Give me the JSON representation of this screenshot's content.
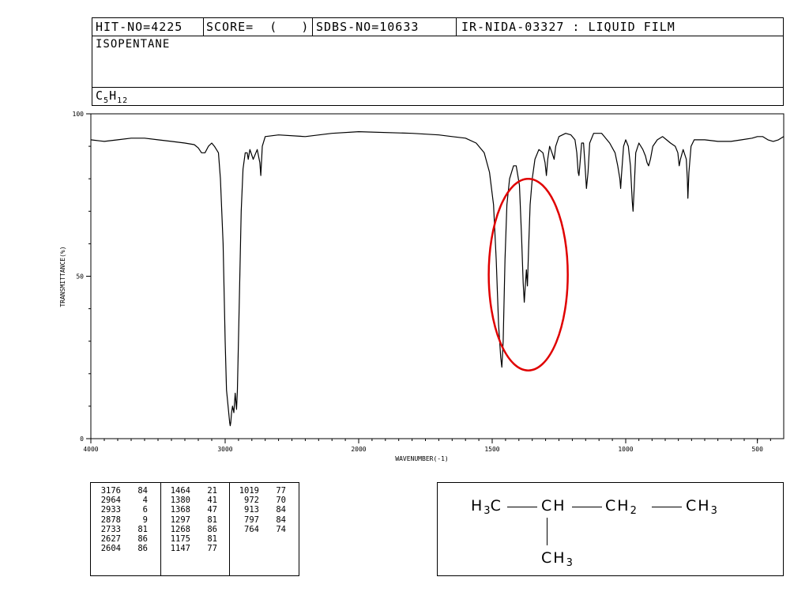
{
  "header": {
    "hit_no": "HIT-NO=4225",
    "score": "SCORE=  (   )",
    "sdbs_no": "SDBS-NO=10633",
    "ir_info": "IR-NIDA-03327 : LIQUID FILM",
    "compound_name": "ISOPENTANE",
    "formula": {
      "c": "C",
      "c_count": "5",
      "h": "H",
      "h_count": "12"
    }
  },
  "chart_data": {
    "type": "line",
    "xlabel": "WAVENUMBER(-1)",
    "ylabel": "TRANSMITTANCE(%)",
    "xlim": [
      4000,
      400
    ],
    "ylim": [
      0,
      100
    ],
    "x_ticks": [
      4000,
      3000,
      2000,
      1500,
      1000,
      500
    ],
    "x_tick_labels": [
      "4000",
      "3000",
      "2000",
      "1500",
      "1000",
      "500"
    ],
    "y_ticks": [
      0,
      50,
      100
    ],
    "y_tick_labels": [
      "0",
      "50",
      "100"
    ],
    "grid": false,
    "series": [
      {
        "color": "#000000",
        "points": [
          [
            4000,
            92
          ],
          [
            3900,
            91.5
          ],
          [
            3800,
            92
          ],
          [
            3700,
            92.5
          ],
          [
            3600,
            92.5
          ],
          [
            3500,
            92
          ],
          [
            3400,
            91.5
          ],
          [
            3300,
            91
          ],
          [
            3230,
            90.5
          ],
          [
            3200,
            89.5
          ],
          [
            3176,
            88
          ],
          [
            3150,
            88
          ],
          [
            3125,
            90
          ],
          [
            3100,
            91
          ],
          [
            3080,
            90
          ],
          [
            3050,
            88
          ],
          [
            3035,
            80
          ],
          [
            3015,
            60
          ],
          [
            3000,
            30
          ],
          [
            2990,
            15
          ],
          [
            2978,
            10
          ],
          [
            2966,
            5
          ],
          [
            2962,
            4
          ],
          [
            2958,
            5
          ],
          [
            2952,
            8
          ],
          [
            2945,
            10
          ],
          [
            2935,
            8
          ],
          [
            2925,
            14
          ],
          [
            2915,
            9
          ],
          [
            2908,
            15
          ],
          [
            2895,
            40
          ],
          [
            2880,
            70
          ],
          [
            2866,
            83
          ],
          [
            2850,
            88
          ],
          [
            2835,
            88
          ],
          [
            2827,
            86
          ],
          [
            2815,
            89
          ],
          [
            2790,
            86
          ],
          [
            2760,
            89
          ],
          [
            2740,
            85
          ],
          [
            2733,
            81
          ],
          [
            2722,
            90
          ],
          [
            2700,
            93
          ],
          [
            2600,
            93.5
          ],
          [
            2400,
            93
          ],
          [
            2200,
            94
          ],
          [
            2000,
            94.5
          ],
          [
            1800,
            94
          ],
          [
            1700,
            93.5
          ],
          [
            1650,
            93
          ],
          [
            1600,
            92.5
          ],
          [
            1560,
            91
          ],
          [
            1530,
            88
          ],
          [
            1510,
            82
          ],
          [
            1495,
            72
          ],
          [
            1485,
            55
          ],
          [
            1476,
            35
          ],
          [
            1468,
            25
          ],
          [
            1464,
            22
          ],
          [
            1459,
            30
          ],
          [
            1452,
            55
          ],
          [
            1445,
            72
          ],
          [
            1435,
            80
          ],
          [
            1420,
            84
          ],
          [
            1410,
            84
          ],
          [
            1398,
            78
          ],
          [
            1390,
            62
          ],
          [
            1384,
            48
          ],
          [
            1380,
            42
          ],
          [
            1376,
            47
          ],
          [
            1372,
            52
          ],
          [
            1368,
            47
          ],
          [
            1364,
            58
          ],
          [
            1358,
            72
          ],
          [
            1350,
            80
          ],
          [
            1340,
            86
          ],
          [
            1325,
            89
          ],
          [
            1310,
            88
          ],
          [
            1302,
            85
          ],
          [
            1297,
            81
          ],
          [
            1292,
            86
          ],
          [
            1285,
            90
          ],
          [
            1276,
            88
          ],
          [
            1268,
            86
          ],
          [
            1262,
            90
          ],
          [
            1250,
            93
          ],
          [
            1225,
            94
          ],
          [
            1205,
            93.5
          ],
          [
            1190,
            92
          ],
          [
            1183,
            88
          ],
          [
            1178,
            82
          ],
          [
            1175,
            81
          ],
          [
            1172,
            84
          ],
          [
            1165,
            91
          ],
          [
            1158,
            91
          ],
          [
            1153,
            85
          ],
          [
            1147,
            77
          ],
          [
            1141,
            82
          ],
          [
            1135,
            91
          ],
          [
            1120,
            94
          ],
          [
            1090,
            94
          ],
          [
            1060,
            91
          ],
          [
            1040,
            88
          ],
          [
            1030,
            84
          ],
          [
            1022,
            80
          ],
          [
            1019,
            77
          ],
          [
            1016,
            81
          ],
          [
            1008,
            90
          ],
          [
            1000,
            92
          ],
          [
            990,
            90
          ],
          [
            982,
            84
          ],
          [
            975,
            73
          ],
          [
            972,
            70
          ],
          [
            968,
            77
          ],
          [
            962,
            88
          ],
          [
            950,
            91
          ],
          [
            935,
            89
          ],
          [
            925,
            87
          ],
          [
            919,
            85
          ],
          [
            913,
            84
          ],
          [
            906,
            86
          ],
          [
            897,
            90
          ],
          [
            880,
            92
          ],
          [
            860,
            93
          ],
          [
            845,
            92
          ],
          [
            830,
            91
          ],
          [
            812,
            90
          ],
          [
            802,
            88
          ],
          [
            797,
            84
          ],
          [
            792,
            86
          ],
          [
            782,
            89
          ],
          [
            770,
            86
          ],
          [
            766,
            80
          ],
          [
            764,
            74
          ],
          [
            760,
            82
          ],
          [
            752,
            90
          ],
          [
            740,
            92
          ],
          [
            700,
            92
          ],
          [
            650,
            91.5
          ],
          [
            600,
            91.5
          ],
          [
            560,
            92
          ],
          [
            520,
            92.5
          ],
          [
            500,
            93
          ],
          [
            480,
            93
          ],
          [
            460,
            92
          ],
          [
            440,
            91.5
          ],
          [
            420,
            92
          ],
          [
            400,
            93
          ]
        ]
      }
    ],
    "annotations": [
      {
        "shape": "ellipse",
        "color": "#e00000",
        "cx": 1365,
        "cy": 50.5,
        "rx": 148,
        "ry": 29.5
      }
    ]
  },
  "peak_table": [
    [
      {
        "wn": "3176",
        "t": "84"
      },
      {
        "wn": "2964",
        "t": "4"
      },
      {
        "wn": "2933",
        "t": "6"
      },
      {
        "wn": "2878",
        "t": "9"
      },
      {
        "wn": "2733",
        "t": "81"
      },
      {
        "wn": "2627",
        "t": "86"
      },
      {
        "wn": "2604",
        "t": "86"
      }
    ],
    [
      {
        "wn": "1464",
        "t": "21"
      },
      {
        "wn": "1380",
        "t": "41"
      },
      {
        "wn": "1368",
        "t": "47"
      },
      {
        "wn": "1297",
        "t": "81"
      },
      {
        "wn": "1268",
        "t": "86"
      },
      {
        "wn": "1175",
        "t": "81"
      },
      {
        "wn": "1147",
        "t": "77"
      }
    ],
    [
      {
        "wn": "1019",
        "t": "77"
      },
      {
        "wn": "972",
        "t": "70"
      },
      {
        "wn": "913",
        "t": "84"
      },
      {
        "wn": "797",
        "t": "84"
      },
      {
        "wn": "764",
        "t": "74"
      }
    ]
  ],
  "structure": {
    "group1": "H",
    "group1_sub": "3",
    "group1_tail": "C",
    "group2": "CH",
    "group3": "CH",
    "group3_sub": "2",
    "group4": "CH",
    "group4_sub": "3",
    "branch": "CH",
    "branch_sub": "3"
  }
}
